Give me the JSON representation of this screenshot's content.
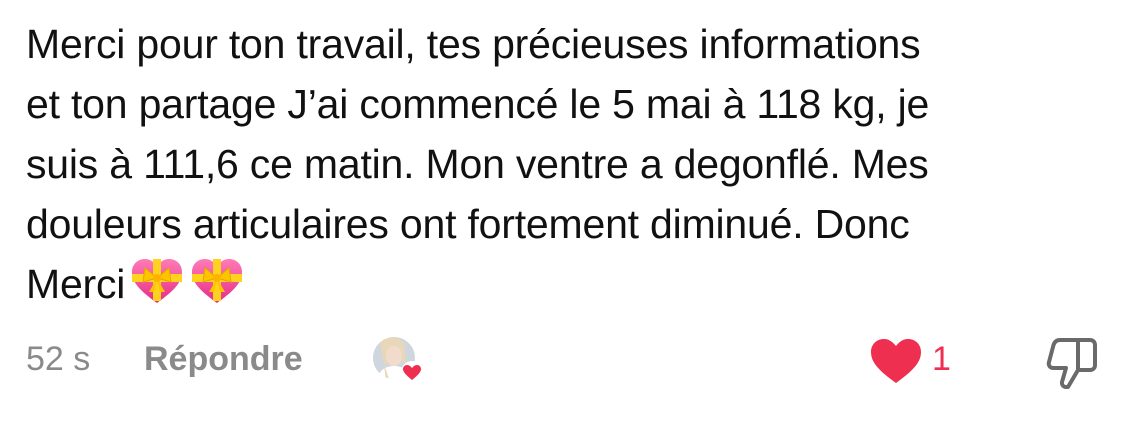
{
  "comment": {
    "lines": [
      "Merci pour ton travail, tes précieuses informations",
      "et ton partage J’ai commencé le 5 mai à 118 kg, je",
      "suis à 111,6 ce matin. Mon ventre a degonflé. Mes",
      "douleurs articulaires ont fortement diminué. Donc",
      "Merci"
    ],
    "emoji": [
      "heart-with-ribbon-icon",
      "heart-with-ribbon-icon"
    ]
  },
  "actions": {
    "time": "52 s",
    "reply_label": "Répondre",
    "like_count": "1",
    "like_color": "#ee2f4f",
    "muted_color": "#8a8a8a"
  }
}
